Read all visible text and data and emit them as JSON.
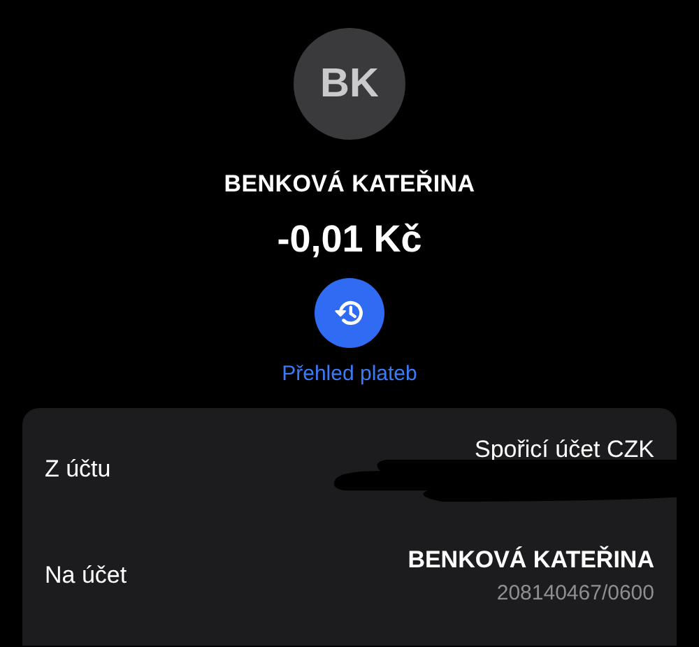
{
  "contact": {
    "initials": "BK",
    "name": "BENKOVÁ KATEŘINA"
  },
  "amount": "-0,01 Kč",
  "history_link": {
    "label": "Přehled plateb"
  },
  "details": [
    {
      "label": "Z účtu",
      "value": "Spořicí účet CZK",
      "redacted": true
    },
    {
      "label": "Na účet",
      "value": "BENKOVÁ KATEŘINA",
      "sub_value": "208140467/0600",
      "redacted": false
    }
  ]
}
